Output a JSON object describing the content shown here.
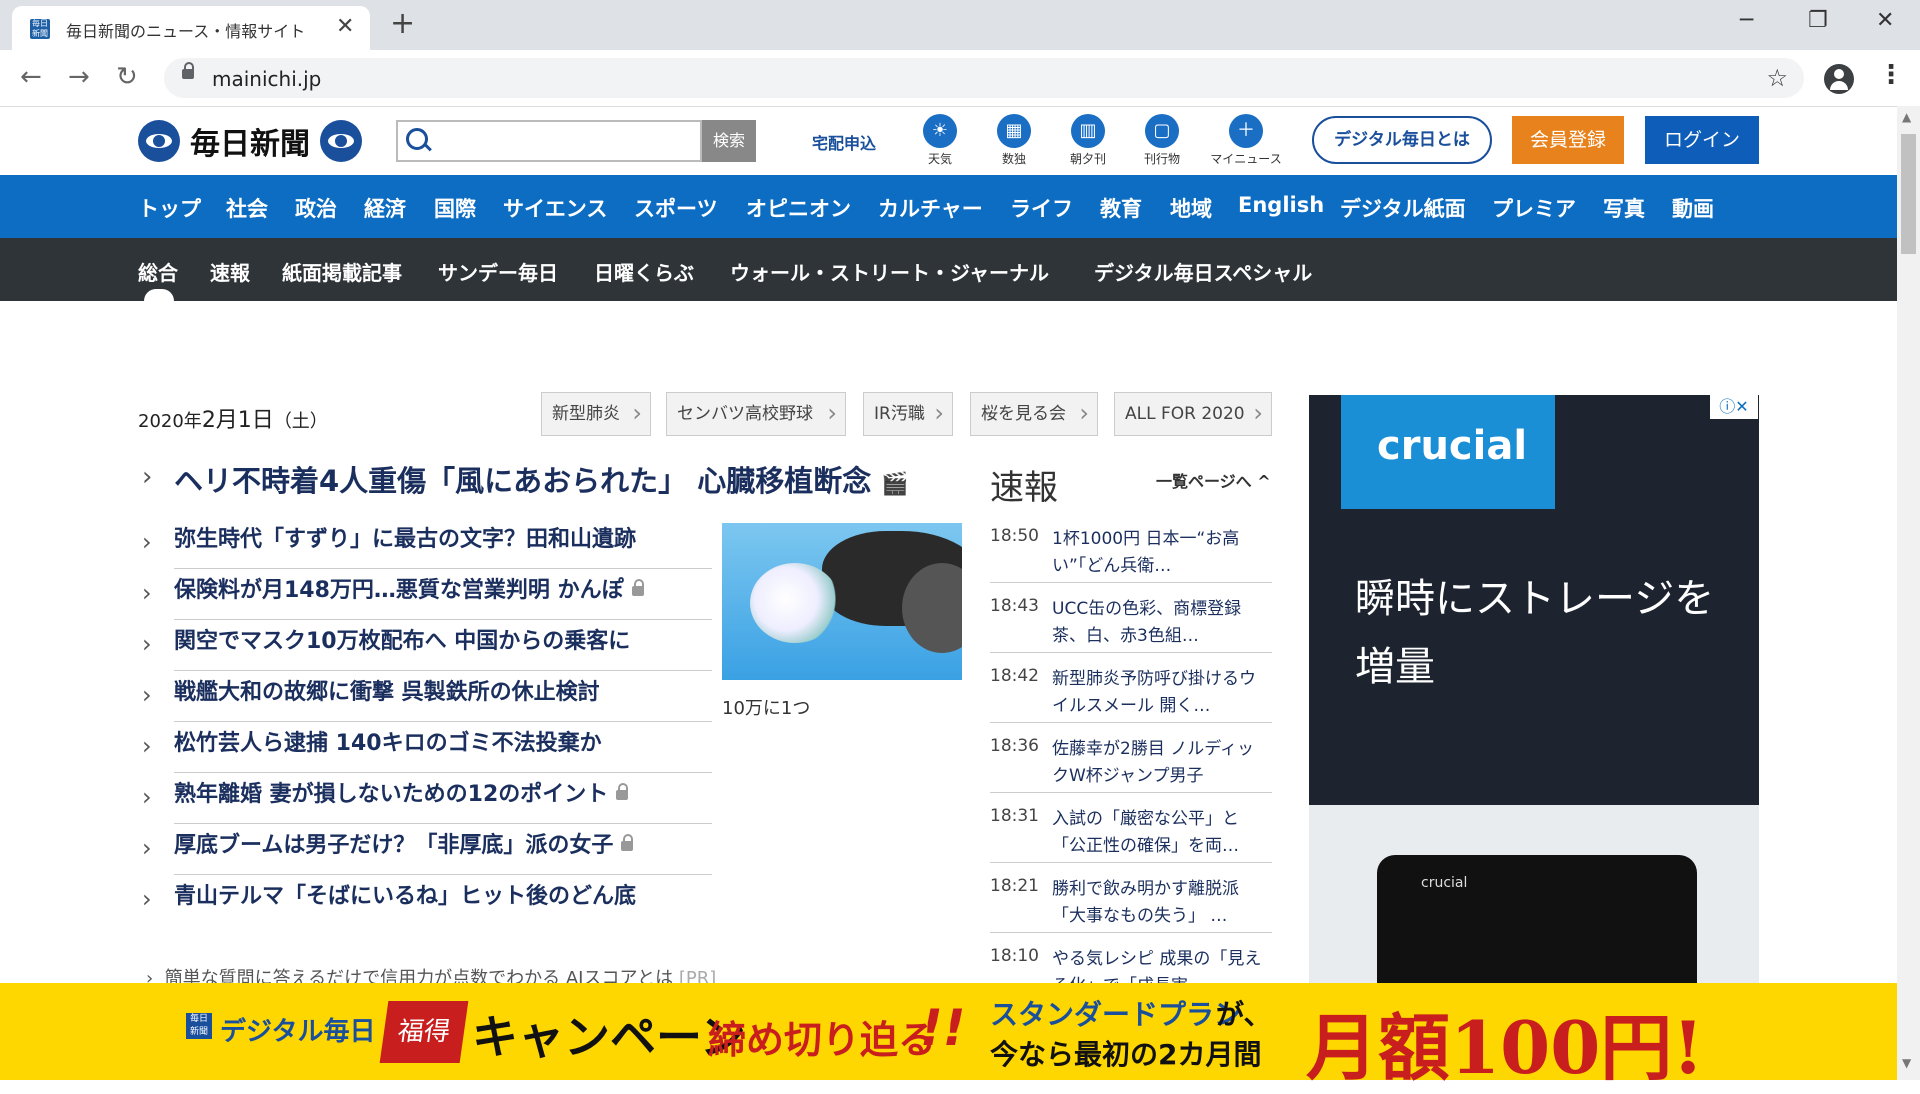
{
  "browser": {
    "tab_title": "毎日新聞のニュース・情報サイト",
    "favicon_text": "毎日新聞",
    "url": "mainichi.jp",
    "new_tab": "+",
    "close": "✕",
    "minimize": "─",
    "restore": "❐",
    "win_close": "✕",
    "back": "←",
    "forward": "→",
    "reload": "↻",
    "star": "☆",
    "menu": "⋮"
  },
  "header": {
    "logo_text": "毎日新聞",
    "search_button": "検索",
    "delivery_link": "宅配申込",
    "icons": [
      {
        "label": "天気",
        "glyph": "☀"
      },
      {
        "label": "数独",
        "glyph": "▦"
      },
      {
        "label": "朝夕刊",
        "glyph": "▥"
      },
      {
        "label": "刊行物",
        "glyph": "▢"
      },
      {
        "label": "マイニュース",
        "glyph": "＋"
      }
    ],
    "digital_button": "デジタル毎日とは",
    "join_button": "会員登録",
    "login_button": "ログイン"
  },
  "main_nav": [
    "トップ",
    "社会",
    "政治",
    "経済",
    "国際",
    "サイエンス",
    "スポーツ",
    "オピニオン",
    "カルチャー",
    "ライフ",
    "教育",
    "地域",
    "English",
    "デジタル紙面",
    "プレミア",
    "写真",
    "動画"
  ],
  "sub_nav": [
    "総合",
    "速報",
    "紙面掲載記事",
    "サンデー毎日",
    "日曜くらぶ",
    "ウォール・ストリート・ジャーナル",
    "デジタル毎日スペシャル"
  ],
  "date": {
    "year": "2020年",
    "day": "2月1日",
    "weekday": "（土）"
  },
  "topics": [
    "新型肺炎",
    "センバツ高校野球",
    "IR汚職",
    "桜を見る会",
    "ALL FOR 2020"
  ],
  "lead_headline": "ヘリ不時着4人重傷「風にあおられた」 心臓移植断念",
  "headlines": [
    {
      "text": "弥生時代「すずり」に最古の文字？田和山遺跡",
      "locked": false
    },
    {
      "text": "保険料が月148万円…悪質な営業判明 かんぽ",
      "locked": true
    },
    {
      "text": "関空でマスク10万枚配布へ 中国からの乗客に",
      "locked": false
    },
    {
      "text": "戦艦大和の故郷に衝撃 呉製鉄所の休止検討",
      "locked": false
    },
    {
      "text": "松竹芸人ら逮捕 140キロのゴミ不法投棄か",
      "locked": false
    },
    {
      "text": "熟年離婚 妻が損しないための12のポイント",
      "locked": true
    },
    {
      "text": "厚底ブームは男子だけ？「非厚底」派の女子",
      "locked": true
    },
    {
      "text": "青山テルマ「そばにいるね」ヒット後のどん底",
      "locked": false
    }
  ],
  "photo_caption": "10万に1つ",
  "pr": {
    "text": "簡単な質問に答えるだけで信用力が点数でわかる AIスコアとは",
    "tag": "[PR]"
  },
  "sokuho": {
    "title": "速報",
    "more": "一覧ページへ",
    "items": [
      {
        "time": "18:50",
        "text": "1杯1000円 日本一“お高い”「どん兵衛…"
      },
      {
        "time": "18:43",
        "text": "UCC缶の色彩、商標登録 茶、白、赤3色組…"
      },
      {
        "time": "18:42",
        "text": "新型肺炎予防呼び掛けるウイルスメール 開く…"
      },
      {
        "time": "18:36",
        "text": "佐藤幸が2勝目 ノルディックW杯ジャンプ男子"
      },
      {
        "time": "18:31",
        "text": "入試の「厳密な公平」と「公正性の確保」を両…"
      },
      {
        "time": "18:21",
        "text": "勝利で飲み明かす離脱派「大事なもの失う」 …"
      },
      {
        "time": "18:10",
        "text": "やる気レシピ 成果の「見える化」で「成長実…"
      }
    ]
  },
  "ad": {
    "brand": "crucial",
    "copy": "瞬時にストレージを増量",
    "ssd_label": "crucial",
    "close_glyphs": "ⓘ✕"
  },
  "banner": {
    "logo": "毎日新聞",
    "digital": "デジタル毎日",
    "fukutoku": "福得",
    "campaign": "キャンペーン",
    "deadline": "締め切り迫る",
    "exclaim": "!!",
    "standard": "スタンダードプラン",
    "ga": "が、",
    "now": "今なら最初の2カ月間",
    "price": "月額100円!"
  }
}
